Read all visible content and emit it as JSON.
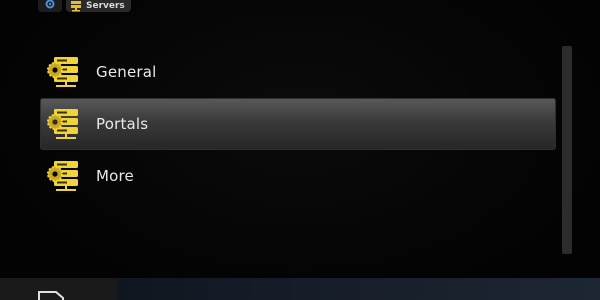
{
  "window": {
    "width": 600,
    "height": 300
  },
  "header": {
    "breadcrumb_label": "Servers",
    "gear_icon": "gear-icon",
    "server_icon": "server-icon"
  },
  "menu": {
    "items": [
      {
        "label": "General",
        "icon": "server-gear-icon",
        "focused": false
      },
      {
        "label": "Portals",
        "icon": "server-gear-icon",
        "focused": true
      },
      {
        "label": "More",
        "icon": "server-gear-icon",
        "focused": false
      }
    ]
  },
  "footer": {
    "tab_icon": "folder-icon"
  },
  "colors": {
    "icon_yellow": "#f1d33a",
    "label_text": "#e9e9e9",
    "focus_bar": "#3a3a3a",
    "background": "#050505",
    "scrollbar": "#2c2c2c"
  }
}
